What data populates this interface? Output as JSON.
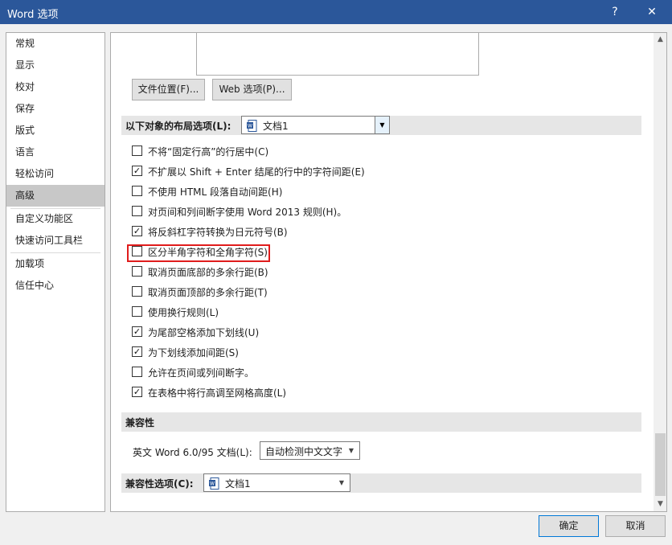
{
  "window": {
    "title": "Word 选项",
    "help": "?",
    "close": "✕"
  },
  "sidebar": {
    "items": [
      {
        "label": "常规"
      },
      {
        "label": "显示"
      },
      {
        "label": "校对"
      },
      {
        "label": "保存"
      },
      {
        "label": "版式"
      },
      {
        "label": "语言"
      },
      {
        "label": "轻松访问"
      },
      {
        "label": "高级",
        "active": true
      },
      {
        "label": "自定义功能区"
      },
      {
        "label": "快速访问工具栏"
      },
      {
        "label": "加载项"
      },
      {
        "label": "信任中心"
      }
    ]
  },
  "buttons": {
    "file_locations": "文件位置(F)...",
    "web_options": "Web 选项(P)..."
  },
  "layout_section": {
    "label": "以下对象的布局选项(L):",
    "document": "文档1",
    "options": [
      {
        "label": "不将“固定行高”的行居中(C)",
        "checked": false
      },
      {
        "label": "不扩展以 Shift + Enter 结尾的行中的字符间距(E)",
        "checked": true
      },
      {
        "label": "不使用 HTML 段落自动间距(H)",
        "checked": false
      },
      {
        "label": "对页间和列间断字使用 Word 2013 规则(H)。",
        "checked": false
      },
      {
        "label": "将反斜杠字符转换为日元符号(B)",
        "checked": true
      },
      {
        "label": "区分半角字符和全角字符(S)",
        "checked": false
      },
      {
        "label": "取消页面底部的多余行距(B)",
        "checked": false
      },
      {
        "label": "取消页面顶部的多余行距(T)",
        "checked": false
      },
      {
        "label": "使用换行规则(L)",
        "checked": false
      },
      {
        "label": "为尾部空格添加下划线(U)",
        "checked": true
      },
      {
        "label": "为下划线添加间距(S)",
        "checked": true
      },
      {
        "label": "允许在页间或列间断字。",
        "checked": false
      },
      {
        "label": "在表格中将行高调至网格高度(L)",
        "checked": true
      }
    ]
  },
  "compat_section": {
    "label": "兼容性",
    "row_label": "英文 Word 6.0/95 文档(L):",
    "row_value": "自动检测中文文字"
  },
  "compat_options_section": {
    "label": "兼容性选项(C):",
    "document": "文档1"
  },
  "footer": {
    "ok": "确定",
    "cancel": "取消"
  },
  "colors": {
    "titlebar": "#2b579a",
    "highlight": "#e01c1c",
    "active_nav": "#c8c8c8"
  }
}
